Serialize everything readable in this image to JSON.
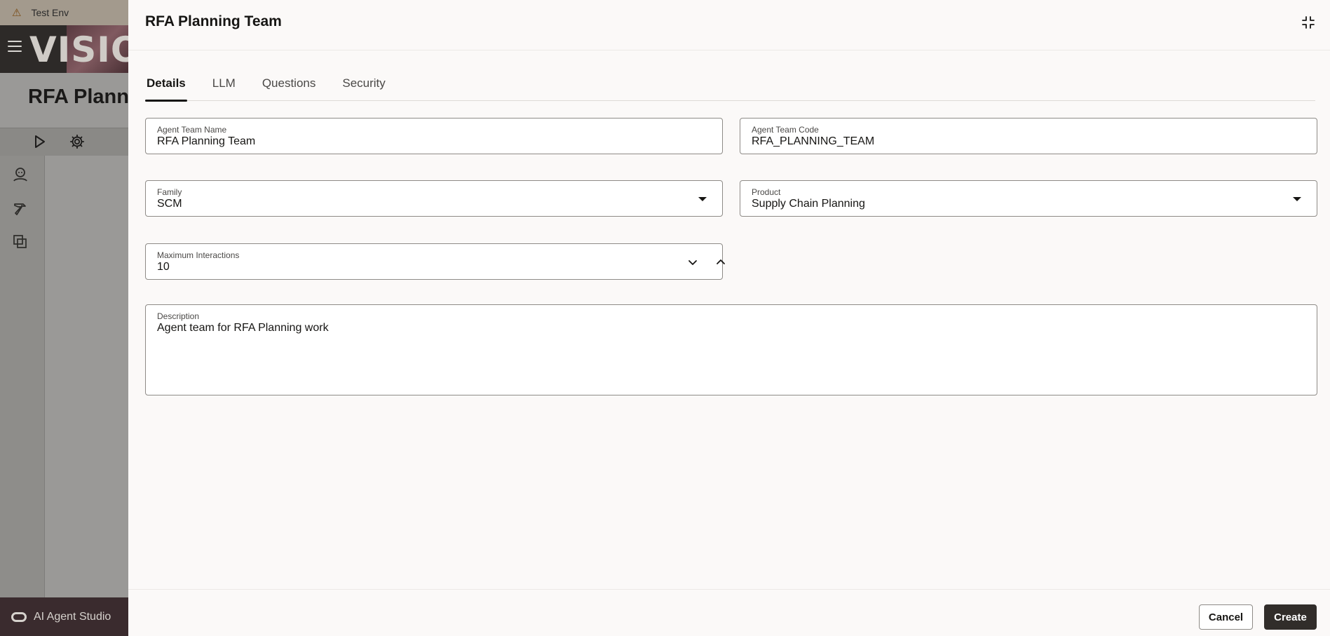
{
  "env": {
    "label": "Test Env"
  },
  "brand": {
    "word": "VISION"
  },
  "background_page": {
    "title": "RFA Planni"
  },
  "studio": {
    "label": "AI Agent Studio"
  },
  "drawer": {
    "title": "RFA Planning Team",
    "tabs": [
      {
        "label": "Details",
        "active": true
      },
      {
        "label": "LLM",
        "active": false
      },
      {
        "label": "Questions",
        "active": false
      },
      {
        "label": "Security",
        "active": false
      }
    ],
    "fields": {
      "team_name": {
        "label": "Agent Team Name",
        "value": "RFA Planning Team"
      },
      "team_code": {
        "label": "Agent Team Code",
        "value": "RFA_PLANNING_TEAM"
      },
      "family": {
        "label": "Family",
        "value": "SCM"
      },
      "product": {
        "label": "Product",
        "value": "Supply Chain Planning"
      },
      "max_interactions": {
        "label": "Maximum Interactions",
        "value": "10"
      },
      "description": {
        "label": "Description",
        "value": "Agent team for RFA Planning work"
      }
    },
    "footer": {
      "cancel_label": "Cancel",
      "create_label": "Create"
    }
  }
}
